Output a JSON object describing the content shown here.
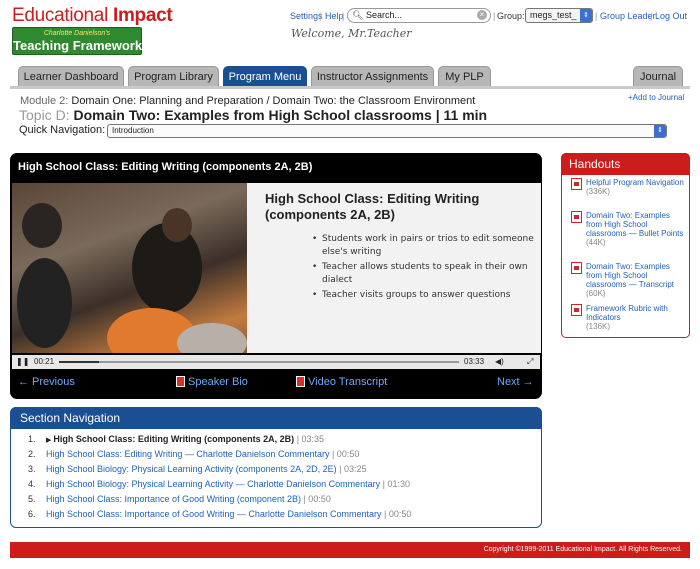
{
  "brand": {
    "name_part1": "Educational ",
    "name_part2": "Impact",
    "subtitle": "Charlotte Danielson's",
    "product": "Teaching Framework"
  },
  "toplinks": {
    "settings": "Settings",
    "help": "Help",
    "search_placeholder": "Search...",
    "group_label": "Group:",
    "group_value": "megs_test_",
    "group_leader": "Group Leader",
    "logout": "Log Out",
    "separator": "|"
  },
  "welcome": "Welcome, Mr.Teacher",
  "tabs": [
    {
      "label": "Learner Dashboard",
      "active": false
    },
    {
      "label": "Program Library",
      "active": false
    },
    {
      "label": "Program Menu",
      "active": true
    },
    {
      "label": "Instructor Assignments",
      "active": false
    },
    {
      "label": "My PLP",
      "active": false
    },
    {
      "label": "Journal",
      "active": false
    }
  ],
  "module": {
    "label": "Module 2:",
    "title": "Domain One: Planning and Preparation / Domain Two: the Classroom Environment",
    "add_to_journal": "+Add to Journal"
  },
  "topic": {
    "label": "Topic D:",
    "title": "Domain Two: Examples from High School classrooms | 11 min"
  },
  "quick_nav": {
    "label": "Quick Navigation:",
    "selected": "Introduction"
  },
  "video": {
    "title": "High School Class: Editing Writing (components 2A, 2B)",
    "slide_heading": "High School Class: Editing Writing (components 2A, 2B)",
    "slide_bullets": [
      "Students work in pairs or trios to edit someone else's writing",
      "Teacher allows students to speak in their own dialect",
      "Teacher visits groups to answer questions"
    ],
    "current_time": "00:21",
    "duration": "03:33",
    "progress": 0.1
  },
  "video_nav": {
    "previous": "← Previous",
    "speaker_bio": "Speaker Bio",
    "video_transcript": "Video Transcript",
    "next": "Next →"
  },
  "section_nav": {
    "heading": "Section Navigation",
    "items": [
      {
        "num": "1.",
        "title": "High School Class: Editing Writing (components 2A, 2B)",
        "duration": "| 03:35",
        "current": true
      },
      {
        "num": "2.",
        "title": "High School Class: Editing Writing — Charlotte Danielson Commentary",
        "duration": "| 00:50",
        "current": false
      },
      {
        "num": "3.",
        "title": "High School Biology: Physical Learning Activity (components 2A, 2D, 2E)",
        "duration": "| 03:25",
        "current": false
      },
      {
        "num": "4.",
        "title": "High School Biology: Physical Learning Activity — Charlotte Danielson Commentary",
        "duration": "| 01:30",
        "current": false
      },
      {
        "num": "5.",
        "title": "High School Class: Importance of Good Writing (component 2B)",
        "duration": "| 00:50",
        "current": false
      },
      {
        "num": "6.",
        "title": "High School Class: Importance of Good Writing — Charlotte Danielson Commentary",
        "duration": "| 00:50",
        "current": false
      }
    ]
  },
  "handouts": {
    "heading": "Handouts",
    "items": [
      {
        "title": "Helpful Program Navigation",
        "size": "(336K)"
      },
      {
        "title": "Domain Two: Examples from High School classrooms — Bullet Points",
        "size": "(44K)"
      },
      {
        "title": "Domain Two: Examples from High School classrooms — Transcript",
        "size": "(60K)"
      },
      {
        "title": "Framework Rubric with Indicators",
        "size": "(136K)"
      }
    ]
  },
  "footer": "Copyright ©1999-2011 Educational Impact. All Rights Reserved.",
  "colors": {
    "brand_red": "#cc1c1c",
    "nav_blue": "#1b4f93",
    "link_blue": "#1f62b8",
    "logo_green": "#2f8a2f"
  }
}
